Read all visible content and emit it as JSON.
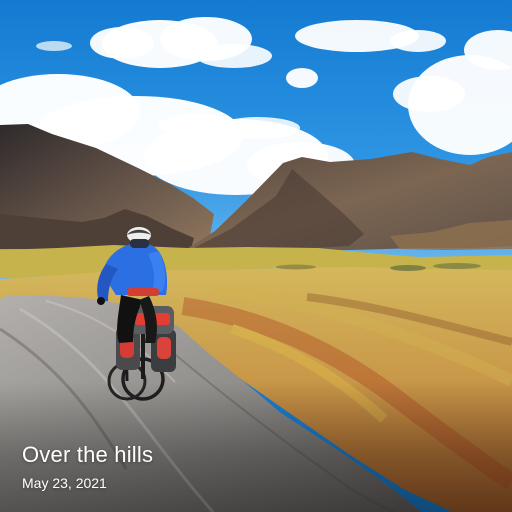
{
  "photo": {
    "title": "Over the hills",
    "date": "May 23, 2021"
  },
  "colors": {
    "sky_top": "#1479cc",
    "sky_bottom": "#4aa3e6",
    "mountain_dark": "#4b3d36",
    "grass_gold": "#c9a34d",
    "road_gray": "#9d9b98",
    "jacket_blue": "#2f6fe0",
    "pannier_red": "#d9453f"
  }
}
